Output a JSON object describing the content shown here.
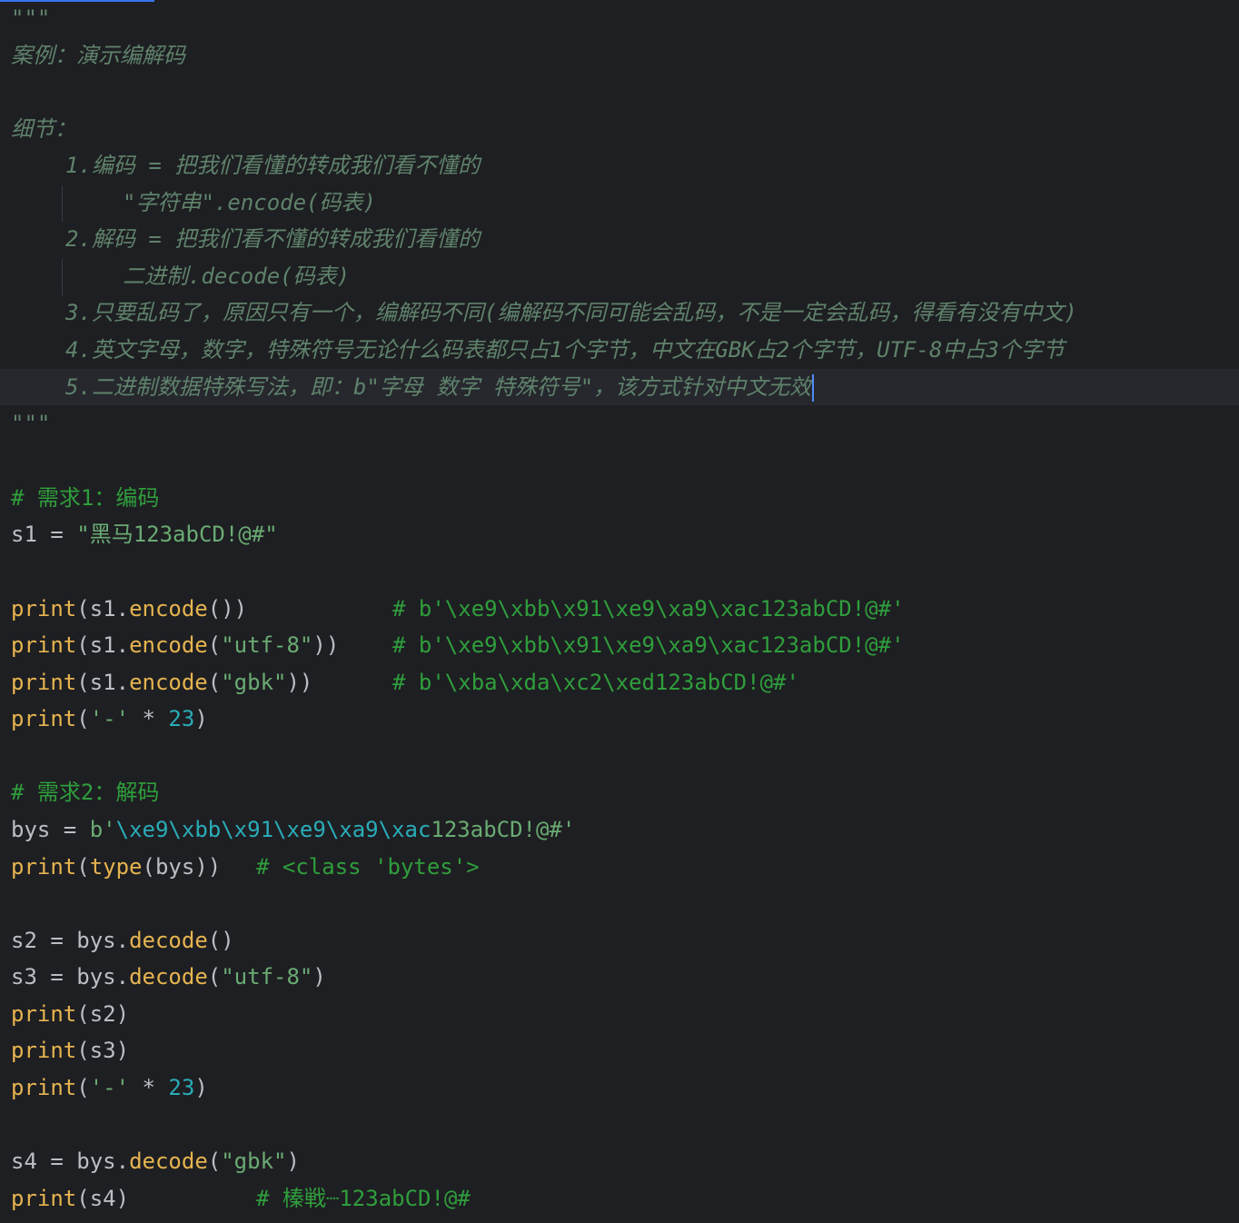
{
  "editor": {
    "doc_open": "\"\"\"",
    "doc_title": "案例：演示编解码",
    "doc_details": "细节：",
    "doc_item1": "1.编码 = 把我们看懂的转成我们看不懂的",
    "doc_item1_sub": "\"字符串\".encode(码表)",
    "doc_item2": "2.解码 = 把我们看不懂的转成我们看懂的",
    "doc_item2_sub": "二进制.decode(码表)",
    "doc_item3": "3.只要乱码了，原因只有一个，编解码不同(编解码不同可能会乱码，不是一定会乱码，得看有没有中文)",
    "doc_item4": "4.英文字母，数字，特殊符号无论什么码表都只占1个字节，中文在GBK占2个字节，UTF-8中占3个字节",
    "doc_item5": "5.二进制数据特殊写法，即：b\"字母 数字 特殊符号\"，该方式针对中文无效",
    "doc_close": "\"\"\"",
    "comment_req1": "# 需求1：编码",
    "s1_name": "s1",
    "s1_value": "\"黑马123abCD!@#\"",
    "print_kw": "print",
    "encode_fn": "encode",
    "decode_fn": "decode",
    "type_fn": "type",
    "utf8_str": "\"utf-8\"",
    "gbk_str": "\"gbk\"",
    "dash_str": "'-'",
    "num_23": "23",
    "comment_enc1": "# b'\\xe9\\xbb\\x91\\xe9\\xa9\\xac123abCD!@#'",
    "comment_enc2": "# b'\\xe9\\xbb\\x91\\xe9\\xa9\\xac123abCD!@#'",
    "comment_enc3": "# b'\\xba\\xda\\xc2\\xed123abCD!@#'",
    "comment_req2": "# 需求2：解码",
    "bys_name": "bys",
    "bys_prefix": "b'",
    "bys_escapes": "\\xe9\\xbb\\x91\\xe9\\xa9\\xac",
    "bys_tail": "123abCD!@#'",
    "comment_type": "# <class 'bytes'>",
    "s2_name": "s2",
    "s3_name": "s3",
    "s4_name": "s4",
    "comment_s4": "# 榛戦┈123abCD!@#"
  },
  "colors": {
    "background": "#1e1f22",
    "current_line": "#26282e",
    "docstring": "#5f826b",
    "keyword": "#e6b450",
    "string": "#6aab73",
    "number": "#2aacb8",
    "comment": "#2f9e3c",
    "caret": "#4f8bf5"
  }
}
